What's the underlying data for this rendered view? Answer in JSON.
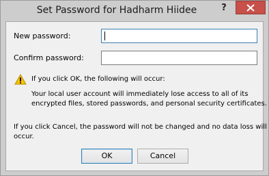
{
  "window": {
    "title": "Set Password for Hadharm Hiidee",
    "help_label": "?"
  },
  "form": {
    "new_password_label": "New password:",
    "new_password_value": "",
    "confirm_password_label": "Confirm password:",
    "confirm_password_value": ""
  },
  "warning": {
    "icon": "warning-triangle-icon",
    "heading": "If you click OK, the following will occur:",
    "line1": "Your local user account will immediately lose access to all of its",
    "line2": "encrypted files, stored passwords, and personal security certificates."
  },
  "cancel_note": {
    "line1": "If you click Cancel, the password will not be changed and no data loss will",
    "line2": "occur."
  },
  "buttons": {
    "ok_label": "OK",
    "cancel_label": "Cancel"
  },
  "colors": {
    "close_button": "#c7504a",
    "focus_border": "#3c7fb1",
    "warning_yellow": "#f5c400"
  }
}
